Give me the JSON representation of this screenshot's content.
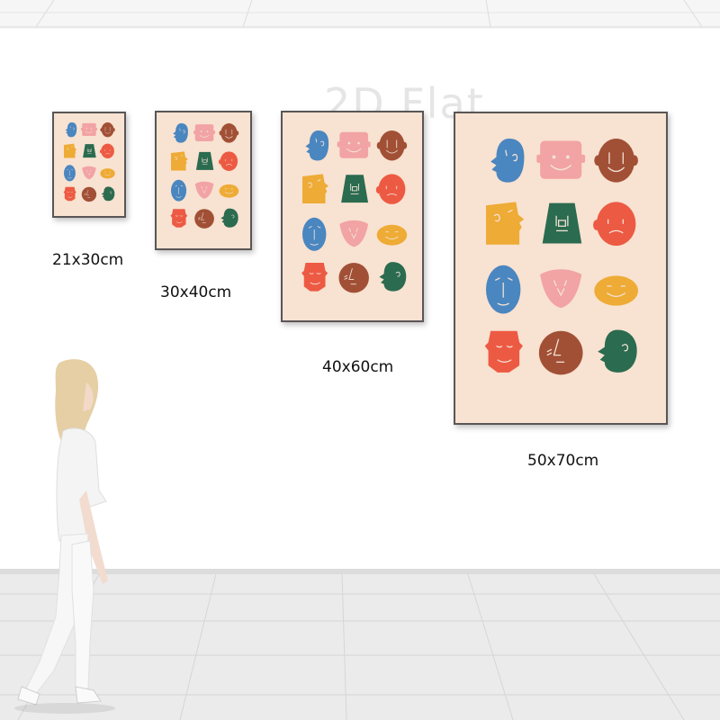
{
  "watermark": "2D Flat",
  "posters": [
    {
      "size_label": "21x30cm"
    },
    {
      "size_label": "30x40cm"
    },
    {
      "size_label": "40x60cm"
    },
    {
      "size_label": "50x70cm"
    }
  ],
  "colors": {
    "poster_background": "#f8e2d1",
    "frame": "#5a5656",
    "blue": "#4a86c0",
    "pink": "#f2a3a3",
    "brown": "#a15036",
    "yellow": "#eeab35",
    "green": "#2b6b4f",
    "red": "#ed5a43",
    "wall": "#ffffff",
    "floor": "#ebebec"
  },
  "faces": [
    {
      "icon": "blue-profile-face-icon",
      "color": "#4a86c0"
    },
    {
      "icon": "pink-square-face-icon",
      "color": "#f2a3a3"
    },
    {
      "icon": "brown-oval-face-icon",
      "color": "#a15036"
    },
    {
      "icon": "yellow-profile-face-icon",
      "color": "#eeab35"
    },
    {
      "icon": "green-trapezoid-face-icon",
      "color": "#2b6b4f"
    },
    {
      "icon": "red-round-face-icon",
      "color": "#ed5a43"
    },
    {
      "icon": "blue-oval-face-icon",
      "color": "#4a86c0"
    },
    {
      "icon": "pink-heart-face-icon",
      "color": "#f2a3a3"
    },
    {
      "icon": "yellow-flat-oval-face-icon",
      "color": "#eeab35"
    },
    {
      "icon": "red-square-face-icon",
      "color": "#ed5a43"
    },
    {
      "icon": "brown-round-face-icon",
      "color": "#a15036"
    },
    {
      "icon": "green-profile-face-icon",
      "color": "#2b6b4f"
    }
  ]
}
